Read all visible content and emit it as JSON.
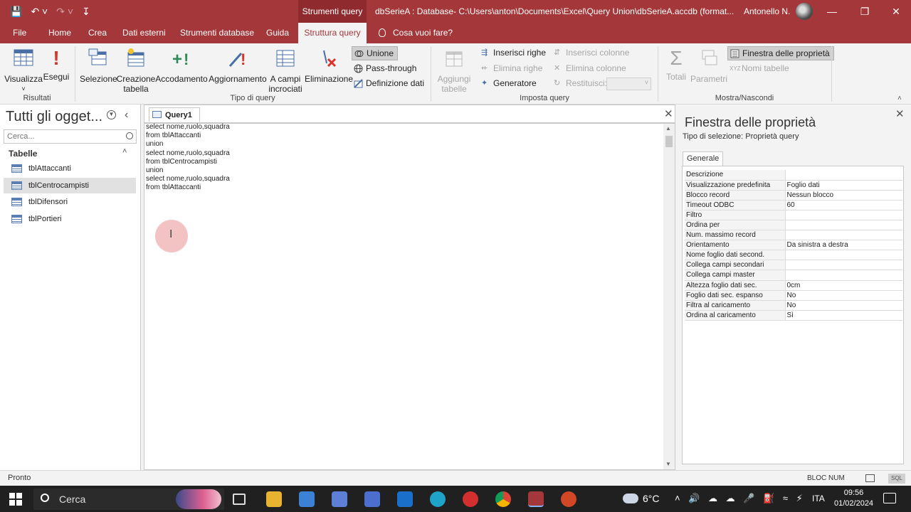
{
  "titlebar": {
    "tools_tab": "Strumenti query",
    "doc_title": "dbSerieA : Database- C:\\Users\\anton\\Documents\\Excel\\Query Union\\dbSerieA.accdb (format...",
    "user": "Antonello N."
  },
  "tabs": [
    {
      "label": "File"
    },
    {
      "label": "Home"
    },
    {
      "label": "Crea"
    },
    {
      "label": "Dati esterni"
    },
    {
      "label": "Strumenti database"
    },
    {
      "label": "Guida"
    },
    {
      "label": "Struttura query"
    }
  ],
  "tell_me": "Cosa vuoi fare?",
  "ribbon": {
    "risultati": {
      "label": "Risultati",
      "visualizza": "Visualizza",
      "esegui": "Esegui"
    },
    "tipo": {
      "label": "Tipo di query",
      "selezione": "Selezione",
      "creazione1": "Creazione",
      "creazione2": "tabella",
      "accodamento": "Accodamento",
      "aggiornamento": "Aggiornamento",
      "campi1": "A campi",
      "campi2": "incrociati",
      "eliminazione": "Eliminazione",
      "unione": "Unione",
      "passthrough": "Pass-through",
      "definizione": "Definizione dati"
    },
    "imposta": {
      "label": "Imposta query",
      "aggiungi1": "Aggiungi",
      "aggiungi2": "tabelle",
      "inserisci_righe": "Inserisci righe",
      "elimina_righe": "Elimina righe",
      "generatore": "Generatore",
      "inserisci_colonne": "Inserisci colonne",
      "elimina_colonne": "Elimina colonne",
      "restituisci": "Restituisci:"
    },
    "mostra": {
      "label": "Mostra/Nascondi",
      "totali": "Totali",
      "parametri": "Parametri",
      "finestra": "Finestra delle proprietà",
      "nomi": "Nomi tabelle"
    }
  },
  "nav": {
    "title": "Tutti gli ogget...",
    "search_placeholder": "Cerca...",
    "group": "Tabelle",
    "items": [
      {
        "label": "tblAttaccanti"
      },
      {
        "label": "tblCentrocampisti"
      },
      {
        "label": "tblDifensori"
      },
      {
        "label": "tblPortieri"
      }
    ]
  },
  "document": {
    "tab_label": "Query1",
    "sql": "select nome,ruolo,squadra\nfrom tblAttaccanti\nunion\nselect nome,ruolo,squadra\nfrom tblCentrocampisti\nunion\nselect nome,ruolo,squadra\nfrom tblAttaccanti"
  },
  "properties": {
    "title": "Finestra delle proprietà",
    "selection_type": "Tipo di selezione:  Proprietà query",
    "tab": "Generale",
    "rows": [
      {
        "k": "Descrizione",
        "v": ""
      },
      {
        "k": "Visualizzazione predefinita",
        "v": "Foglio dati"
      },
      {
        "k": "Blocco record",
        "v": "Nessun blocco"
      },
      {
        "k": "Timeout ODBC",
        "v": "60"
      },
      {
        "k": "Filtro",
        "v": ""
      },
      {
        "k": "Ordina per",
        "v": ""
      },
      {
        "k": "Num. massimo record",
        "v": ""
      },
      {
        "k": "Orientamento",
        "v": "Da sinistra a destra"
      },
      {
        "k": "Nome foglio dati second.",
        "v": ""
      },
      {
        "k": "Collega campi secondari",
        "v": ""
      },
      {
        "k": "Collega campi master",
        "v": ""
      },
      {
        "k": "Altezza foglio dati sec.",
        "v": "0cm"
      },
      {
        "k": "Foglio dati sec. espanso",
        "v": "No"
      },
      {
        "k": "Filtra al caricamento",
        "v": "No"
      },
      {
        "k": "Ordina al caricamento",
        "v": "Sì"
      }
    ]
  },
  "status": {
    "text": "Pronto",
    "num": "BLOC NUM",
    "view_sql": "SQL"
  },
  "taskbar": {
    "search": "Cerca",
    "weather": "6°C",
    "lang": "ITA",
    "time": "09:56",
    "date": "01/02/2024"
  },
  "colors": {
    "accent": "#a4373a",
    "accent_dark": "#8f2b2e"
  }
}
